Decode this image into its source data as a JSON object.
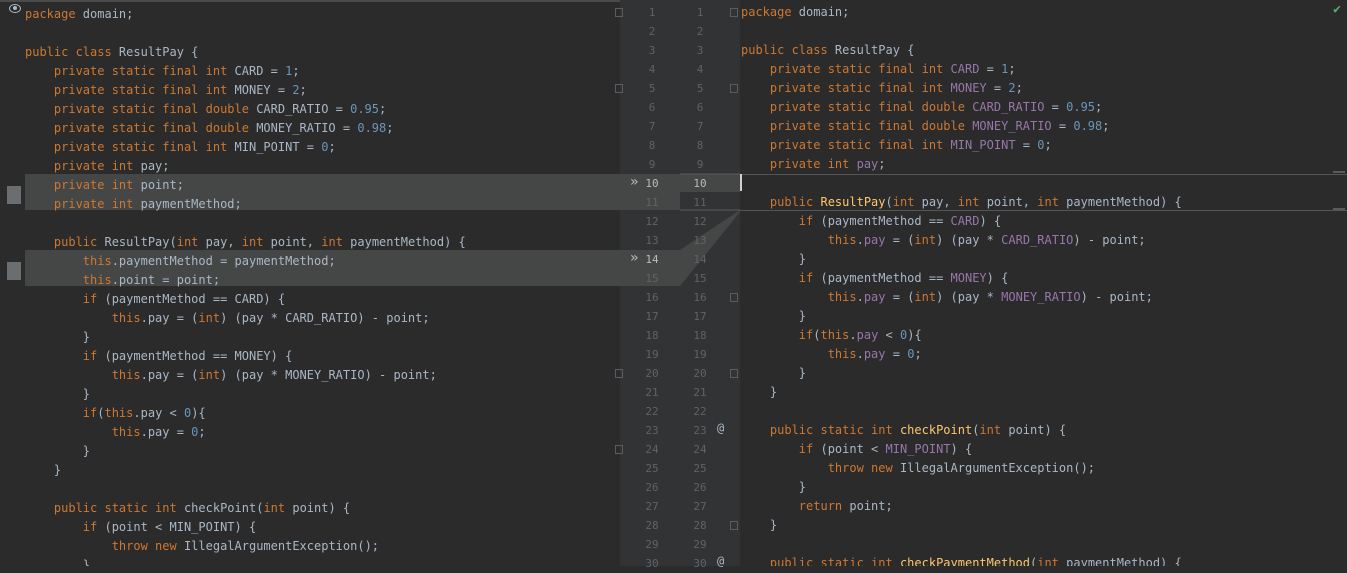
{
  "left": {
    "lines": [
      [
        [
          "kw",
          "package "
        ],
        [
          "plain",
          "domain;"
        ]
      ],
      [],
      [
        [
          "kw",
          "public class "
        ],
        [
          "plain",
          "ResultPay {"
        ]
      ],
      [
        [
          "kw",
          "    private static final int "
        ],
        [
          "plain",
          "CARD = "
        ],
        [
          "num",
          "1"
        ],
        [
          "plain",
          ";"
        ]
      ],
      [
        [
          "kw",
          "    private static final int "
        ],
        [
          "plain",
          "MONEY = "
        ],
        [
          "num",
          "2"
        ],
        [
          "plain",
          ";"
        ]
      ],
      [
        [
          "kw",
          "    private static final double "
        ],
        [
          "plain",
          "CARD_RATIO = "
        ],
        [
          "num",
          "0.95"
        ],
        [
          "plain",
          ";"
        ]
      ],
      [
        [
          "kw",
          "    private static final double "
        ],
        [
          "plain",
          "MONEY_RATIO = "
        ],
        [
          "num",
          "0.98"
        ],
        [
          "plain",
          ";"
        ]
      ],
      [
        [
          "kw",
          "    private static final int "
        ],
        [
          "plain",
          "MIN_POINT = "
        ],
        [
          "num",
          "0"
        ],
        [
          "plain",
          ";"
        ]
      ],
      [
        [
          "kw",
          "    private int "
        ],
        [
          "plain",
          "pay;"
        ]
      ],
      [
        [
          "kw",
          "    private int "
        ],
        [
          "plain",
          "point;"
        ]
      ],
      [
        [
          "kw",
          "    private int "
        ],
        [
          "plain",
          "paymentMethod;"
        ]
      ],
      [],
      [
        [
          "kw",
          "    public "
        ],
        [
          "plain",
          "ResultPay("
        ],
        [
          "kw",
          "int "
        ],
        [
          "plain",
          "pay, "
        ],
        [
          "kw",
          "int "
        ],
        [
          "plain",
          "point, "
        ],
        [
          "kw",
          "int "
        ],
        [
          "plain",
          "paymentMethod) {"
        ]
      ],
      [
        [
          "kw",
          "        this"
        ],
        [
          "plain",
          ".paymentMethod = paymentMethod;"
        ]
      ],
      [
        [
          "kw",
          "        this"
        ],
        [
          "plain",
          ".point = point;"
        ]
      ],
      [
        [
          "kw",
          "        if "
        ],
        [
          "plain",
          "(paymentMethod == CARD) {"
        ]
      ],
      [
        [
          "kw",
          "            this"
        ],
        [
          "plain",
          ".pay = ("
        ],
        [
          "kw",
          "int"
        ],
        [
          "plain",
          ") (pay * CARD_RATIO) - point;"
        ]
      ],
      [
        [
          "plain",
          "        }"
        ]
      ],
      [
        [
          "kw",
          "        if "
        ],
        [
          "plain",
          "(paymentMethod == MONEY) {"
        ]
      ],
      [
        [
          "kw",
          "            this"
        ],
        [
          "plain",
          ".pay = ("
        ],
        [
          "kw",
          "int"
        ],
        [
          "plain",
          ") (pay * MONEY_RATIO) - point;"
        ]
      ],
      [
        [
          "plain",
          "        }"
        ]
      ],
      [
        [
          "kw",
          "        if"
        ],
        [
          "plain",
          "("
        ],
        [
          "kw",
          "this"
        ],
        [
          "plain",
          ".pay < "
        ],
        [
          "num",
          "0"
        ],
        [
          "plain",
          "){"
        ]
      ],
      [
        [
          "kw",
          "            this"
        ],
        [
          "plain",
          ".pay = "
        ],
        [
          "num",
          "0"
        ],
        [
          "plain",
          ";"
        ]
      ],
      [
        [
          "plain",
          "        }"
        ]
      ],
      [
        [
          "plain",
          "    }"
        ]
      ],
      [],
      [
        [
          "kw",
          "    public static int "
        ],
        [
          "plain",
          "checkPoint("
        ],
        [
          "kw",
          "int "
        ],
        [
          "plain",
          "point) {"
        ]
      ],
      [
        [
          "kw",
          "        if "
        ],
        [
          "plain",
          "(point < MIN_POINT) {"
        ]
      ],
      [
        [
          "kw",
          "            throw new "
        ],
        [
          "plain",
          "IllegalArgumentException();"
        ]
      ],
      [
        [
          "plain",
          "        }"
        ]
      ]
    ]
  },
  "right": {
    "lines": [
      [
        [
          "kw",
          "package "
        ],
        [
          "plain",
          "domain;"
        ]
      ],
      [],
      [
        [
          "kw",
          "public class "
        ],
        [
          "plain",
          "ResultPay {"
        ]
      ],
      [
        [
          "kw",
          "    private static final int "
        ],
        [
          "fld",
          "CARD"
        ],
        [
          "plain",
          " = "
        ],
        [
          "num",
          "1"
        ],
        [
          "plain",
          ";"
        ]
      ],
      [
        [
          "kw",
          "    private static final int "
        ],
        [
          "fld",
          "MONEY"
        ],
        [
          "plain",
          " = "
        ],
        [
          "num",
          "2"
        ],
        [
          "plain",
          ";"
        ]
      ],
      [
        [
          "kw",
          "    private static final double "
        ],
        [
          "fld",
          "CARD_RATIO"
        ],
        [
          "plain",
          " = "
        ],
        [
          "num",
          "0.95"
        ],
        [
          "plain",
          ";"
        ]
      ],
      [
        [
          "kw",
          "    private static final double "
        ],
        [
          "fld",
          "MONEY_RATIO"
        ],
        [
          "plain",
          " = "
        ],
        [
          "num",
          "0.98"
        ],
        [
          "plain",
          ";"
        ]
      ],
      [
        [
          "kw",
          "    private static final int "
        ],
        [
          "fld",
          "MIN_POINT"
        ],
        [
          "plain",
          " = "
        ],
        [
          "num",
          "0"
        ],
        [
          "plain",
          ";"
        ]
      ],
      [
        [
          "kw",
          "    private int "
        ],
        [
          "fld",
          "pay"
        ],
        [
          "plain",
          ";"
        ]
      ],
      [],
      [
        [
          "kw",
          "    public "
        ],
        [
          "mth",
          "ResultPay"
        ],
        [
          "plain",
          "("
        ],
        [
          "kw",
          "int "
        ],
        [
          "plain",
          "pay, "
        ],
        [
          "kw",
          "int "
        ],
        [
          "plain",
          "point, "
        ],
        [
          "kw",
          "int "
        ],
        [
          "plain",
          "paymentMethod) {"
        ]
      ],
      [
        [
          "kw",
          "        if "
        ],
        [
          "plain",
          "(paymentMethod == "
        ],
        [
          "fld",
          "CARD"
        ],
        [
          "plain",
          ") {"
        ]
      ],
      [
        [
          "kw",
          "            this"
        ],
        [
          "plain",
          "."
        ],
        [
          "fld",
          "pay"
        ],
        [
          "plain",
          " = ("
        ],
        [
          "kw",
          "int"
        ],
        [
          "plain",
          ") (pay * "
        ],
        [
          "fld",
          "CARD_RATIO"
        ],
        [
          "plain",
          ") - point;"
        ]
      ],
      [
        [
          "plain",
          "        }"
        ]
      ],
      [
        [
          "kw",
          "        if "
        ],
        [
          "plain",
          "(paymentMethod == "
        ],
        [
          "fld",
          "MONEY"
        ],
        [
          "plain",
          ") {"
        ]
      ],
      [
        [
          "kw",
          "            this"
        ],
        [
          "plain",
          "."
        ],
        [
          "fld",
          "pay"
        ],
        [
          "plain",
          " = ("
        ],
        [
          "kw",
          "int"
        ],
        [
          "plain",
          ") (pay * "
        ],
        [
          "fld",
          "MONEY_RATIO"
        ],
        [
          "plain",
          ") - point;"
        ]
      ],
      [
        [
          "plain",
          "        }"
        ]
      ],
      [
        [
          "kw",
          "        if"
        ],
        [
          "plain",
          "("
        ],
        [
          "kw",
          "this"
        ],
        [
          "plain",
          "."
        ],
        [
          "fld",
          "pay"
        ],
        [
          "plain",
          " < "
        ],
        [
          "num",
          "0"
        ],
        [
          "plain",
          "){"
        ]
      ],
      [
        [
          "kw",
          "            this"
        ],
        [
          "plain",
          "."
        ],
        [
          "fld",
          "pay"
        ],
        [
          "plain",
          " = "
        ],
        [
          "num",
          "0"
        ],
        [
          "plain",
          ";"
        ]
      ],
      [
        [
          "plain",
          "        }"
        ]
      ],
      [
        [
          "plain",
          "    }"
        ]
      ],
      [],
      [
        [
          "kw",
          "    public static int "
        ],
        [
          "mth",
          "checkPoint"
        ],
        [
          "plain",
          "("
        ],
        [
          "kw",
          "int "
        ],
        [
          "plain",
          "point) {"
        ]
      ],
      [
        [
          "kw",
          "        if "
        ],
        [
          "plain",
          "(point < "
        ],
        [
          "fld",
          "MIN_POINT"
        ],
        [
          "plain",
          ") {"
        ]
      ],
      [
        [
          "kw",
          "            throw new "
        ],
        [
          "plain",
          "IllegalArgumentException();"
        ]
      ],
      [
        [
          "plain",
          "        }"
        ]
      ],
      [
        [
          "kw",
          "        return "
        ],
        [
          "plain",
          "point;"
        ]
      ],
      [
        [
          "plain",
          "    }"
        ]
      ],
      [],
      [
        [
          "kw",
          "    public static int "
        ],
        [
          "mth",
          "checkPaymentMethod"
        ],
        [
          "plain",
          "("
        ],
        [
          "kw",
          "int "
        ],
        [
          "plain",
          "paymentMethod) {"
        ]
      ]
    ]
  },
  "gutter": {
    "left_numbers": [
      "1",
      "2",
      "3",
      "4",
      "5",
      "6",
      "7",
      "8",
      "9",
      "10",
      "11",
      "12",
      "13",
      "14",
      "15",
      "16",
      "17",
      "18",
      "19",
      "20",
      "21",
      "22",
      "23",
      "24",
      "25",
      "26",
      "27",
      "28",
      "29",
      "30"
    ],
    "right_numbers": [
      "1",
      "2",
      "3",
      "4",
      "5",
      "6",
      "7",
      "8",
      "9",
      "10",
      "11",
      "12",
      "13",
      "14",
      "15",
      "16",
      "17",
      "18",
      "19",
      "20",
      "21",
      "22",
      "23",
      "24",
      "25",
      "26",
      "27",
      "28",
      "29",
      "30"
    ],
    "arrow_glyph": "»",
    "annotation_glyph": "@"
  },
  "icons": {
    "left_top": "eye-icon",
    "right_top": "check-icon",
    "check_glyph": "✔"
  },
  "colors": {
    "background": "#2b2b2b",
    "keyword": "#cc7832",
    "number": "#6897bb",
    "field": "#9876aa",
    "method": "#ffc66d",
    "text": "#a9b7c6",
    "changed_band": "#454747"
  }
}
